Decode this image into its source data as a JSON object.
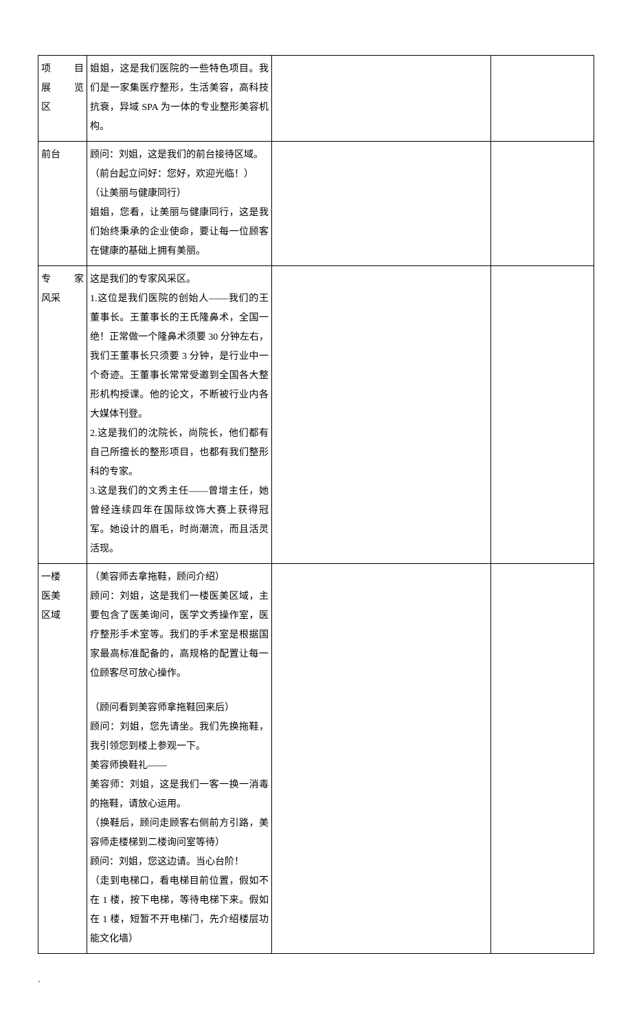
{
  "rows": [
    {
      "label_lines": [
        "项 目",
        "展 览",
        "区"
      ],
      "label_justify": [
        true,
        true,
        false
      ],
      "content": "姐姐，这是我们医院的一些特色项目。我们是一家集医疗整形，生活美容，高科技抗衰，异域 SPA 为一体的专业整形美容机构。"
    },
    {
      "label_lines": [
        "前台"
      ],
      "label_justify": [
        false
      ],
      "content": "顾问：刘姐，这是我们的前台接待区域。\n（前台起立问好：您好，欢迎光临！）\n（让美丽与健康同行）\n姐姐，您看，让美丽与健康同行，这是我们始终秉承的企业使命，要让每一位顾客在健康的基础上拥有美丽。"
    },
    {
      "label_lines": [
        "专 家",
        "风采"
      ],
      "label_justify": [
        true,
        false
      ],
      "content": "这是我们的专家风采区。\n1.这位是我们医院的创始人——我们的王董事长。王董事长的王氏隆鼻术，全国一绝！正常做一个隆鼻术须要 30 分钟左右，我们王董事长只须要 3 分钟，是行业中一个奇迹。王董事长常常受邀到全国各大整形机构授课。他的论文，不断被行业内各大媒体刊登。\n2.这是我们的沈院长，尚院长，他们都有自己所擅长的整形项目，也都有我们整形科的专家。\n3.这是我们的文秀主任——曾增主任，她曾经连续四年在国际纹饰大赛上获得冠军。她设计的眉毛，时尚潮流，而且活灵活现。"
    },
    {
      "label_lines": [
        "一楼",
        "医美",
        "区域"
      ],
      "label_justify": [
        false,
        false,
        false
      ],
      "content": "（美容师去拿拖鞋，顾问介绍）\n顾问：刘姐，这是我们一楼医美区域，主要包含了医美询问，医学文秀操作室，医疗整形手术室等。我们的手术室是根据国家最高标准配备的，高规格的配置让每一位顾客尽可放心操作。\n\n（顾问看到美容师拿拖鞋回来后）\n顾问：刘姐，您先请坐。我们先换拖鞋，我引领您到楼上参观一下。\n美容师换鞋礼——\n美容师：刘姐，这是我们一客一换一消毒的拖鞋，请放心运用。\n（换鞋后，顾问走顾客右侧前方引路，美容师走楼梯到二楼询问室等待）\n顾问：刘姐，您这边请。当心台阶！\n（走到电梯口，看电梯目前位置，假如不在 1 楼，按下电梯，等待电梯下来。假如在 1 楼，短暂不开电梯门，先介绍楼层功能文化墙）"
    }
  ],
  "footer": "."
}
